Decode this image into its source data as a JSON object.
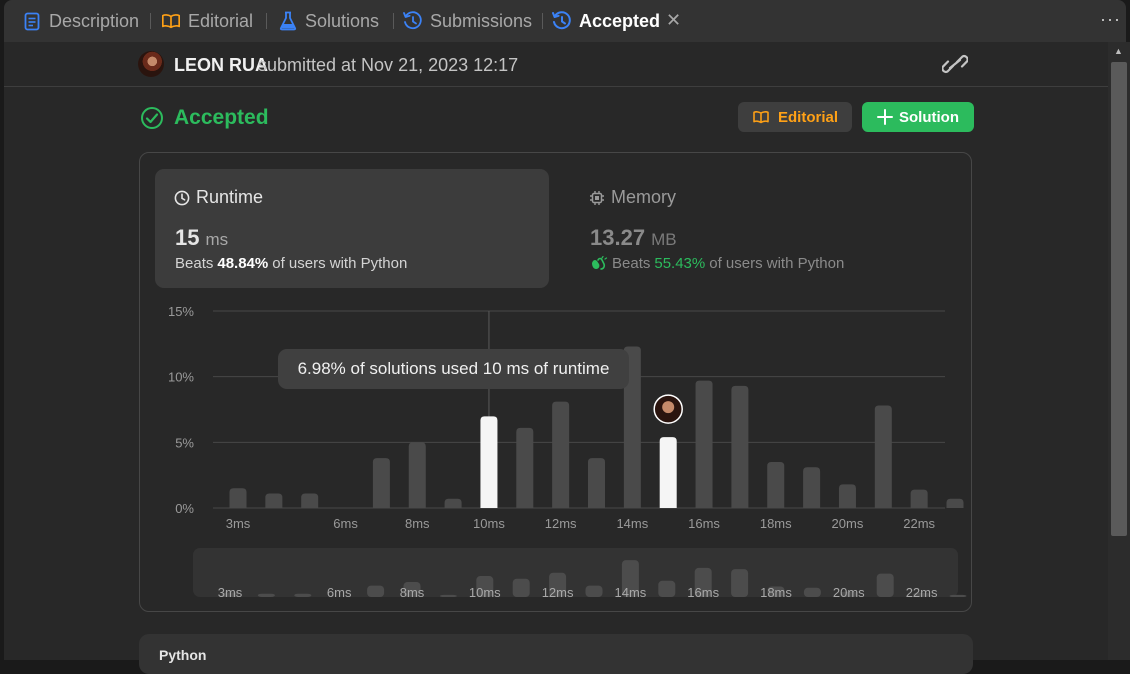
{
  "tabs": [
    {
      "label": "Description",
      "icon": "document-icon"
    },
    {
      "label": "Editorial",
      "icon": "book-icon"
    },
    {
      "label": "Solutions",
      "icon": "flask-icon"
    },
    {
      "label": "Submissions",
      "icon": "history-icon"
    },
    {
      "label": "Accepted",
      "icon": "history-icon",
      "active": true
    }
  ],
  "more_label": "···",
  "submission": {
    "user": "LEON RUA",
    "submitted_text": "submitted at Nov 21, 2023 12:17"
  },
  "status": {
    "label": "Accepted",
    "editorial_button": "Editorial",
    "solution_button": "Solution"
  },
  "runtime": {
    "label": "Runtime",
    "value": "15",
    "unit": "ms",
    "beats_prefix": "Beats",
    "beats_pct": "48.84%",
    "beats_suffix": "of users with Python"
  },
  "memory": {
    "label": "Memory",
    "value": "13.27",
    "unit": "MB",
    "beats_prefix": "Beats",
    "beats_pct": "55.43%",
    "beats_suffix": "of users with Python"
  },
  "tooltip": "6.98% of solutions used 10 ms of runtime",
  "chart_data": {
    "type": "bar",
    "x_values": [
      3,
      4,
      5,
      7,
      8,
      9,
      10,
      11,
      12,
      13,
      14,
      15,
      16,
      17,
      18,
      19,
      20,
      21,
      22,
      23
    ],
    "values": [
      1.5,
      1.1,
      1.1,
      3.8,
      5.0,
      0.7,
      6.98,
      6.1,
      8.1,
      3.8,
      12.3,
      5.4,
      9.7,
      9.3,
      3.5,
      3.1,
      1.8,
      7.8,
      1.4,
      0.7
    ],
    "highlight_x": [
      10,
      15
    ],
    "user_x": 15,
    "hover_x": 10,
    "ylim": [
      0,
      15
    ],
    "y_ticks": [
      "0%",
      "5%",
      "10%",
      "15%"
    ],
    "x_tick_labels": [
      "3ms",
      "6ms",
      "8ms",
      "10ms",
      "12ms",
      "14ms",
      "16ms",
      "18ms",
      "20ms",
      "22ms"
    ],
    "colors": {
      "bar": "#4a4a4a",
      "highlight": "#f5f5f5",
      "grid": "#474747",
      "navigator_bar": "#4c4c4c"
    }
  },
  "language": "Python",
  "colors": {
    "accent_green": "#2cbb5d",
    "accent_orange": "#ffa116"
  }
}
